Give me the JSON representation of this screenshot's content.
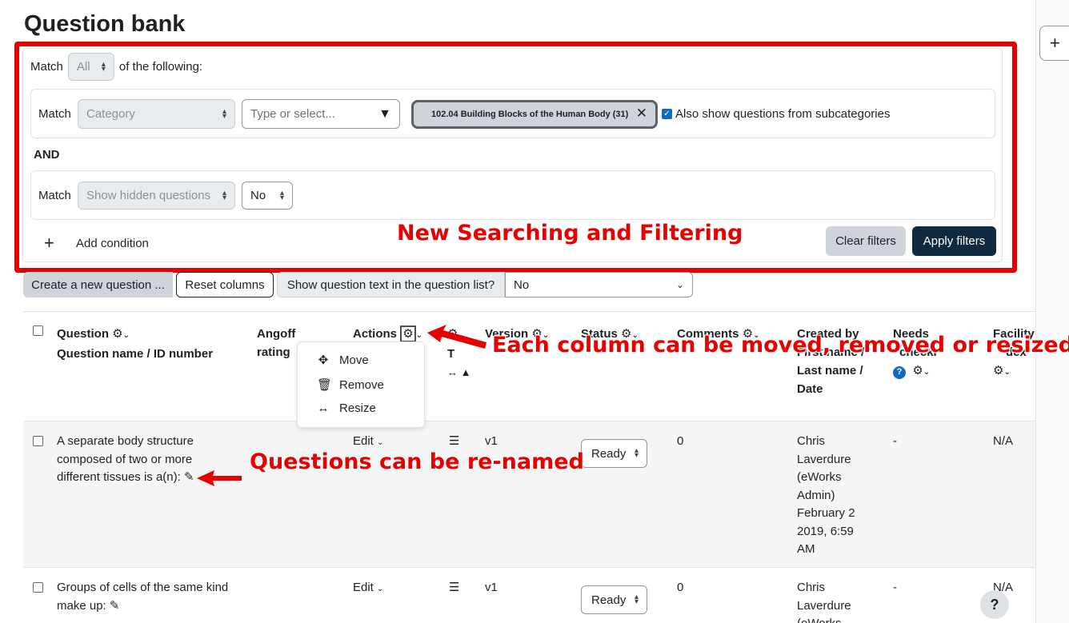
{
  "page": {
    "title": "Question bank"
  },
  "filter": {
    "match_label": "Match",
    "match_value": "All",
    "of_following": "of the following:",
    "conditions": [
      {
        "match_label": "Match",
        "type": "Category",
        "search_placeholder": "Type or select...",
        "chip": "102.04 Building Blocks of the Human Body (31)",
        "subcategories_label": "Also show questions from subcategories"
      },
      {
        "match_label": "Match",
        "type": "Show hidden questions",
        "value": "No"
      }
    ],
    "and_label": "AND",
    "add_condition": "Add condition",
    "clear_filters": "Clear filters",
    "apply_filters": "Apply filters"
  },
  "toolbar": {
    "create_new": "Create a new question ...",
    "reset_columns": "Reset columns",
    "show_text_label": "Show question text in the question list?",
    "show_text_value": "No"
  },
  "table": {
    "headers": {
      "question": "Question",
      "question_sub": "Question name / ID number",
      "angoff": "Angoff rating",
      "actions": "Actions",
      "t": "T",
      "version": "Version",
      "status": "Status",
      "comments": "Comments",
      "created_by": "Created by",
      "created_by_sub": "First name / Last name / Date",
      "needs": "Needs",
      "needs_sub": "checki",
      "facility": "Facility",
      "facility_sub": "dex"
    },
    "column_menu": [
      "Move",
      "Remove",
      "Resize"
    ],
    "rows": [
      {
        "question": "A separate body structure composed of two or more different tissues is a(n):",
        "action": "Edit",
        "version": "v1",
        "status": "Ready",
        "comments": "0",
        "created_by": "Chris Laverdure (eWorks Admin) February 2 2019, 6:59 AM",
        "needs": "-",
        "facility": "N/A"
      },
      {
        "question": "Groups of cells of the same kind make up:",
        "action": "Edit",
        "version": "v1",
        "status": "Ready",
        "comments": "0",
        "created_by": "Chris Laverdure (eWorks",
        "needs": "-",
        "facility": "N/A"
      }
    ]
  },
  "annotations": {
    "filtering": "New Searching and Filtering",
    "columns": "Each column can be moved, removed or resized",
    "renamed": "Questions can be re-named",
    "color": "#e60000"
  },
  "help_button": "?"
}
